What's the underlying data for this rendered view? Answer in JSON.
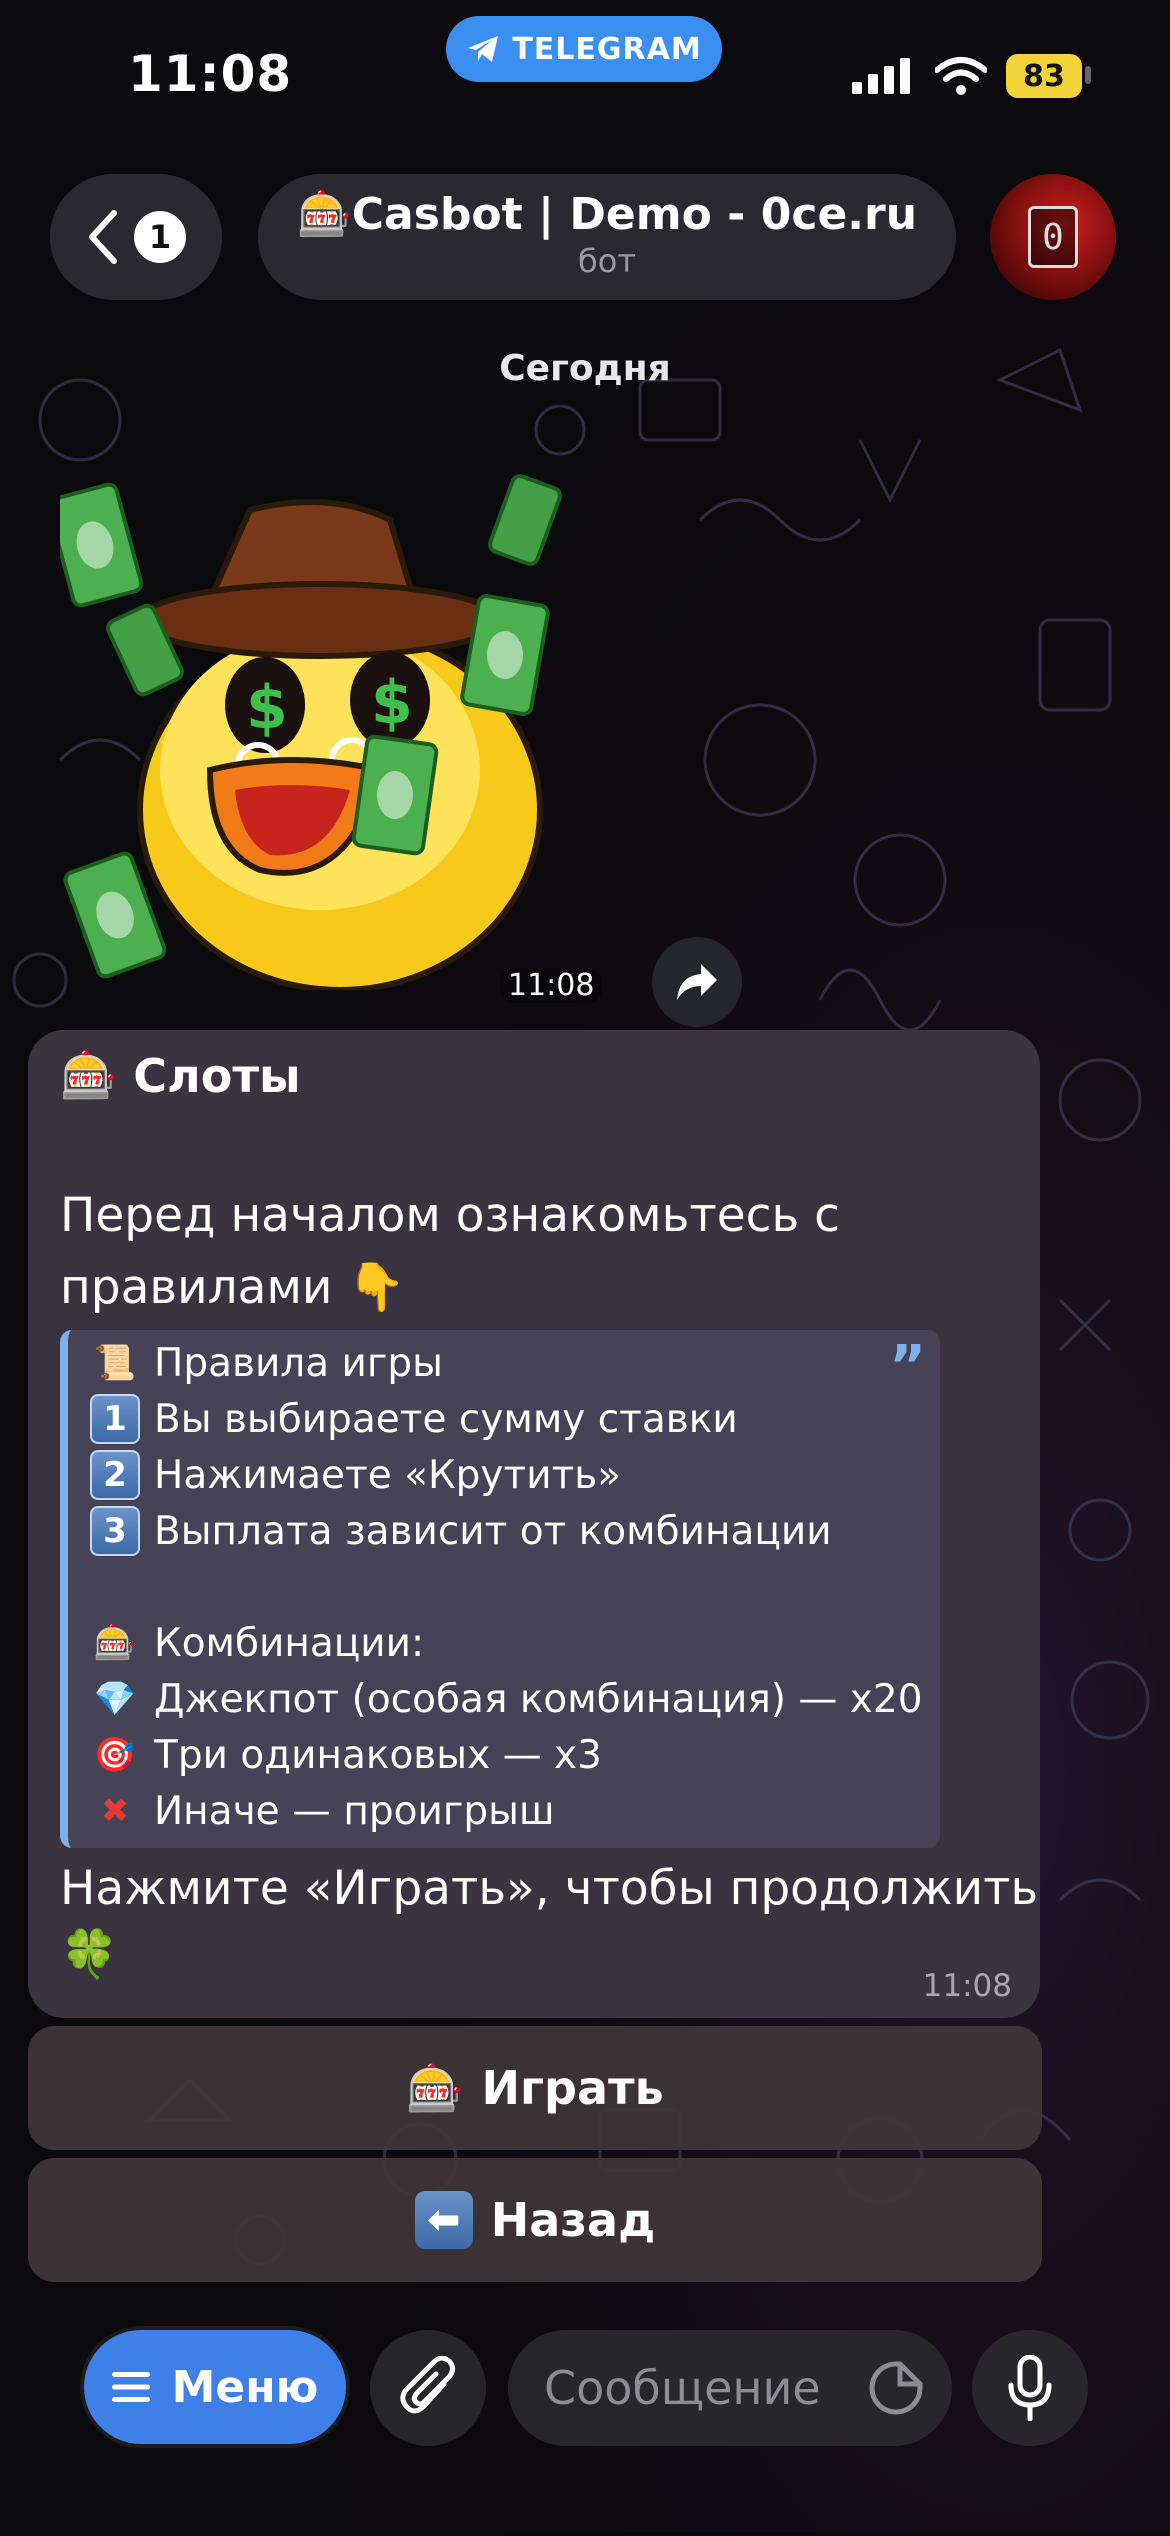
{
  "status_bar": {
    "time": "11:08",
    "app_badge": "TELEGRAM",
    "battery": "83"
  },
  "header": {
    "back_count": "1",
    "chat_title": "Casbot | Demo - 0ce.ru",
    "chat_subtitle": "бот",
    "avatar_char": "0"
  },
  "date_separator": "Сегодня",
  "sticker_message": {
    "time": "11:08"
  },
  "message": {
    "title": "Слоты",
    "intro": "Перед началом ознакомьтесь с правилами",
    "quote": {
      "rules_title": "Правила игры",
      "step1": "Вы выбираете сумму ставки",
      "step2": "Нажимаете «Крутить»",
      "step3": "Выплата зависит от комбинации",
      "combos_title": "Комбинации:",
      "jackpot": "Джекпот (особая комбинация) — x20",
      "three_same": "Три одинаковых — x3",
      "otherwise": "Иначе — проигрыш"
    },
    "footer": "Нажмите «Играть», чтобы продолжить",
    "time": "11:08"
  },
  "buttons": {
    "play": "Играть",
    "back": "Назад"
  },
  "input_bar": {
    "menu_label": "Меню",
    "placeholder": "Сообщение"
  },
  "colors": {
    "accent": "#3f7fe8",
    "bubble": "#3a3340",
    "quote_bar": "#7fb0e8",
    "battery": "#f2d43a"
  },
  "icons": {
    "slot": "slot-machine-icon",
    "scroll": "scroll-icon",
    "diamond": "diamond-icon",
    "target": "target-icon",
    "cross": "cross-icon",
    "clover": "clover-icon",
    "point_down": "point-down-icon",
    "back_arrow": "back-arrow-icon"
  }
}
